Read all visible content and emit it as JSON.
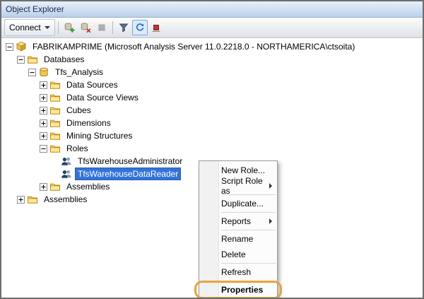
{
  "window": {
    "title": "Object Explorer"
  },
  "toolbar": {
    "connect_label": "Connect",
    "buttons": [
      {
        "icon": "connect-server-icon",
        "disabled": false,
        "pressed": false
      },
      {
        "icon": "disconnect-server-icon",
        "disabled": false,
        "pressed": false
      },
      {
        "icon": "stop-icon",
        "disabled": true,
        "pressed": false
      },
      {
        "separator": true
      },
      {
        "icon": "filter-icon",
        "disabled": false,
        "pressed": false
      },
      {
        "icon": "refresh-icon",
        "disabled": false,
        "pressed": true
      },
      {
        "icon": "stop-refresh-icon",
        "disabled": false,
        "pressed": false
      }
    ]
  },
  "tree": {
    "items": [
      {
        "label": "FABRIKAMPRIME (Microsoft Analysis Server 11.0.2218.0 - NORTHAMERICA\\ctsoita)",
        "level": 0,
        "expander": "collapse",
        "icon": "server-icon",
        "selected": false
      },
      {
        "label": "Databases",
        "level": 1,
        "expander": "collapse",
        "icon": "folder-icon",
        "selected": false
      },
      {
        "label": "Tfs_Analysis",
        "level": 2,
        "expander": "collapse",
        "icon": "database-icon",
        "selected": false
      },
      {
        "label": "Data Sources",
        "level": 3,
        "expander": "expand",
        "icon": "folder-icon",
        "selected": false
      },
      {
        "label": "Data Source Views",
        "level": 3,
        "expander": "expand",
        "icon": "folder-icon",
        "selected": false
      },
      {
        "label": "Cubes",
        "level": 3,
        "expander": "expand",
        "icon": "folder-icon",
        "selected": false
      },
      {
        "label": "Dimensions",
        "level": 3,
        "expander": "expand",
        "icon": "folder-icon",
        "selected": false
      },
      {
        "label": "Mining Structures",
        "level": 3,
        "expander": "expand",
        "icon": "folder-icon",
        "selected": false
      },
      {
        "label": "Roles",
        "level": 3,
        "expander": "collapse",
        "icon": "folder-icon",
        "selected": false
      },
      {
        "label": "TfsWarehouseAdministrator",
        "level": 4,
        "expander": "none",
        "icon": "role-icon",
        "selected": false
      },
      {
        "label": "TfsWarehouseDataReader",
        "level": 4,
        "expander": "none",
        "icon": "role-icon",
        "selected": true
      },
      {
        "label": "Assemblies",
        "level": 3,
        "expander": "expand",
        "icon": "folder-icon",
        "selected": false
      },
      {
        "label": "Assemblies",
        "level": 1,
        "expander": "expand",
        "icon": "folder-icon",
        "selected": false
      }
    ]
  },
  "context_menu": {
    "items": [
      {
        "type": "item",
        "label": "New Role..."
      },
      {
        "type": "item",
        "label": "Script Role as",
        "submenu": true
      },
      {
        "type": "separator"
      },
      {
        "type": "item",
        "label": "Duplicate..."
      },
      {
        "type": "separator"
      },
      {
        "type": "item",
        "label": "Reports",
        "submenu": true
      },
      {
        "type": "separator"
      },
      {
        "type": "item",
        "label": "Rename"
      },
      {
        "type": "item",
        "label": "Delete"
      },
      {
        "type": "separator"
      },
      {
        "type": "item",
        "label": "Refresh"
      },
      {
        "type": "separator"
      },
      {
        "type": "item",
        "label": "Properties",
        "bold": true,
        "highlighted": true
      }
    ]
  },
  "colors": {
    "selection": "#3373D9",
    "annotation": "#E8A33D"
  }
}
